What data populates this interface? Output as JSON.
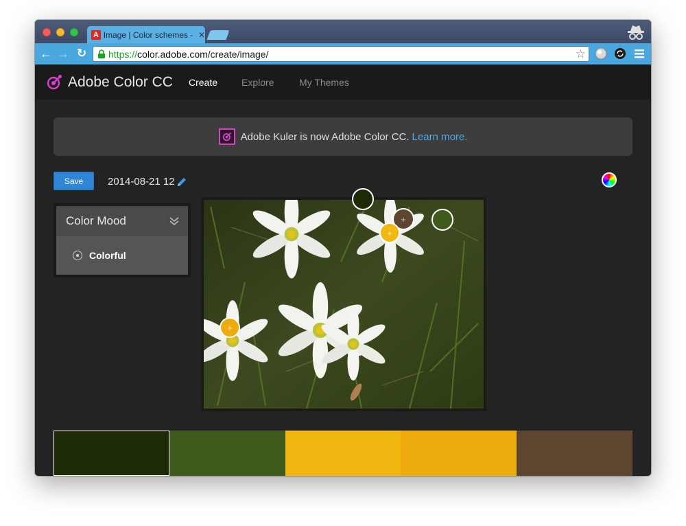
{
  "browser": {
    "tab_title": "Image | Color schemes - A",
    "url_scheme": "https://",
    "url_host": "color.adobe.com",
    "url_path": "/create/image/"
  },
  "app": {
    "title": "Adobe Color CC",
    "nav": [
      {
        "label": "Create",
        "active": true
      },
      {
        "label": "Explore",
        "active": false
      },
      {
        "label": "My Themes",
        "active": false
      }
    ]
  },
  "banner": {
    "text": "Adobe Kuler is now Adobe Color CC.",
    "link_text": "Learn more."
  },
  "theme": {
    "save_label": "Save",
    "name": "2014-08-21 12"
  },
  "mood": {
    "title": "Color Mood",
    "selected": "Colorful"
  },
  "icons": {
    "logo": "kuler-logo-icon",
    "edit": "pencil-icon",
    "color_wheel": "color-wheel-icon",
    "dropdown": "chevron-down-icon",
    "radio": "radio-icon"
  },
  "palette": {
    "colors": [
      "#1c2a06",
      "#3f5a1c",
      "#f0b810",
      "#eeab0e",
      "#5c4630"
    ],
    "selected_index": 0,
    "accent": "#2f86d6",
    "link": "#4fa8e6",
    "brand": "#d93fd0"
  }
}
